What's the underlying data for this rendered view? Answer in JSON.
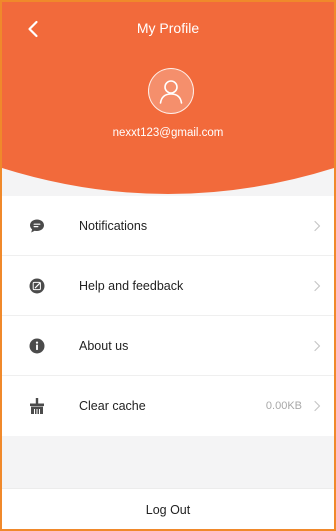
{
  "header": {
    "title": "My Profile",
    "email": "nexxt123@gmail.com",
    "accent_color": "#f26a3b"
  },
  "icons": {
    "back": "chevron-left-icon",
    "avatar": "user-icon",
    "notifications": "chat-bubble-icon",
    "help": "edit-icon",
    "about": "info-icon",
    "cache": "broom-icon",
    "chevron": "chevron-right-icon"
  },
  "menu": {
    "items": [
      {
        "label": "Notifications"
      },
      {
        "label": "Help and feedback"
      },
      {
        "label": "About us"
      },
      {
        "label": "Clear cache",
        "value": "0.00KB"
      }
    ]
  },
  "footer": {
    "logout_label": "Log Out"
  }
}
